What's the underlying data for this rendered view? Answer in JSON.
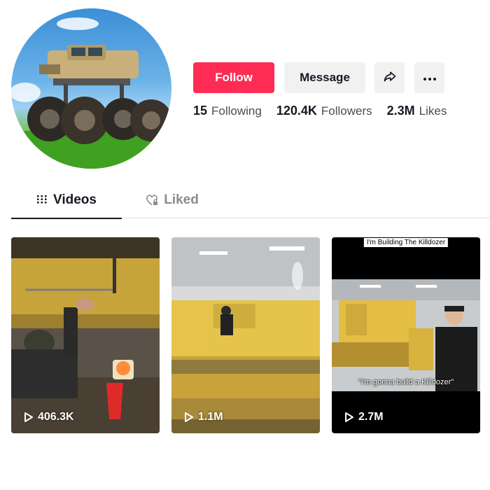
{
  "profile": {
    "avatar_icon": "monster-truck-avatar"
  },
  "actions": {
    "follow_label": "Follow",
    "message_label": "Message",
    "share_icon": "share-arrow-icon",
    "more_icon": "more-dots-icon"
  },
  "stats": {
    "following_count": "15",
    "following_label": "Following",
    "followers_count": "120.4K",
    "followers_label": "Followers",
    "likes_count": "2.3M",
    "likes_label": "Likes"
  },
  "tabs": [
    {
      "label": "Videos",
      "icon": "grid-icon",
      "active": true
    },
    {
      "label": "Liked",
      "icon": "heart-lock-icon",
      "active": false
    }
  ],
  "videos": [
    {
      "views": "406.3K"
    },
    {
      "views": "1.1M"
    },
    {
      "views": "2.7M",
      "top_caption": "I'm Building The Killdozer",
      "mid_caption": "\"I'm gonna build a Killdozer\""
    }
  ],
  "colors": {
    "accent": "#fe2c55",
    "button_bg": "#f1f1f2",
    "text": "#161823",
    "muted": "#8a8b91"
  }
}
